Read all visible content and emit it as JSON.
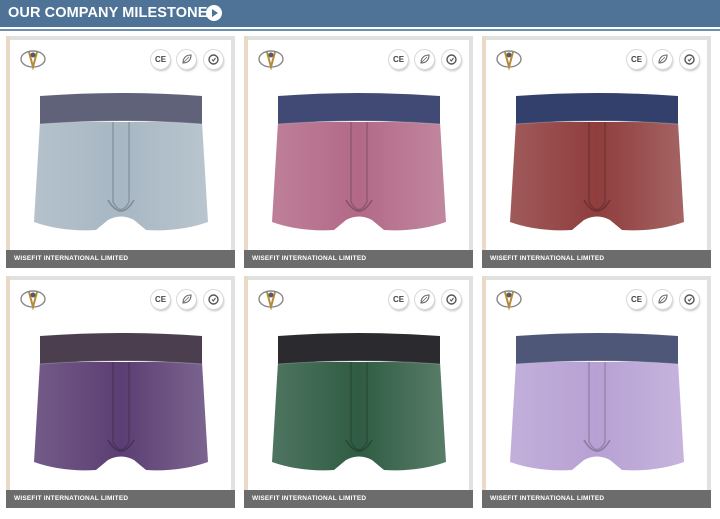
{
  "header": {
    "title": "OUR COMPANY MILESTONES"
  },
  "cards": [
    {
      "footer": "WISEFIT INTERNATIONAL LIMITED",
      "cert_ce": "CE",
      "color": "#a7b7c3",
      "band": "#5f6279"
    },
    {
      "footer": "WISEFIT INTERNATIONAL LIMITED",
      "cert_ce": "CE",
      "color": "#b26987",
      "band": "#404a74"
    },
    {
      "footer": "WISEFIT INTERNATIONAL LIMITED",
      "cert_ce": "CE",
      "color": "#8f3d3d",
      "band": "#32406b"
    },
    {
      "footer": "WISEFIT INTERNATIONAL LIMITED",
      "cert_ce": "CE",
      "color": "#5b3e73",
      "band": "#4a3e4f"
    },
    {
      "footer": "WISEFIT INTERNATIONAL LIMITED",
      "cert_ce": "CE",
      "color": "#2f5c43",
      "band": "#2a2a2f"
    },
    {
      "footer": "WISEFIT INTERNATIONAL LIMITED",
      "cert_ce": "CE",
      "color": "#b7a1d4",
      "band": "#4e5778"
    }
  ]
}
